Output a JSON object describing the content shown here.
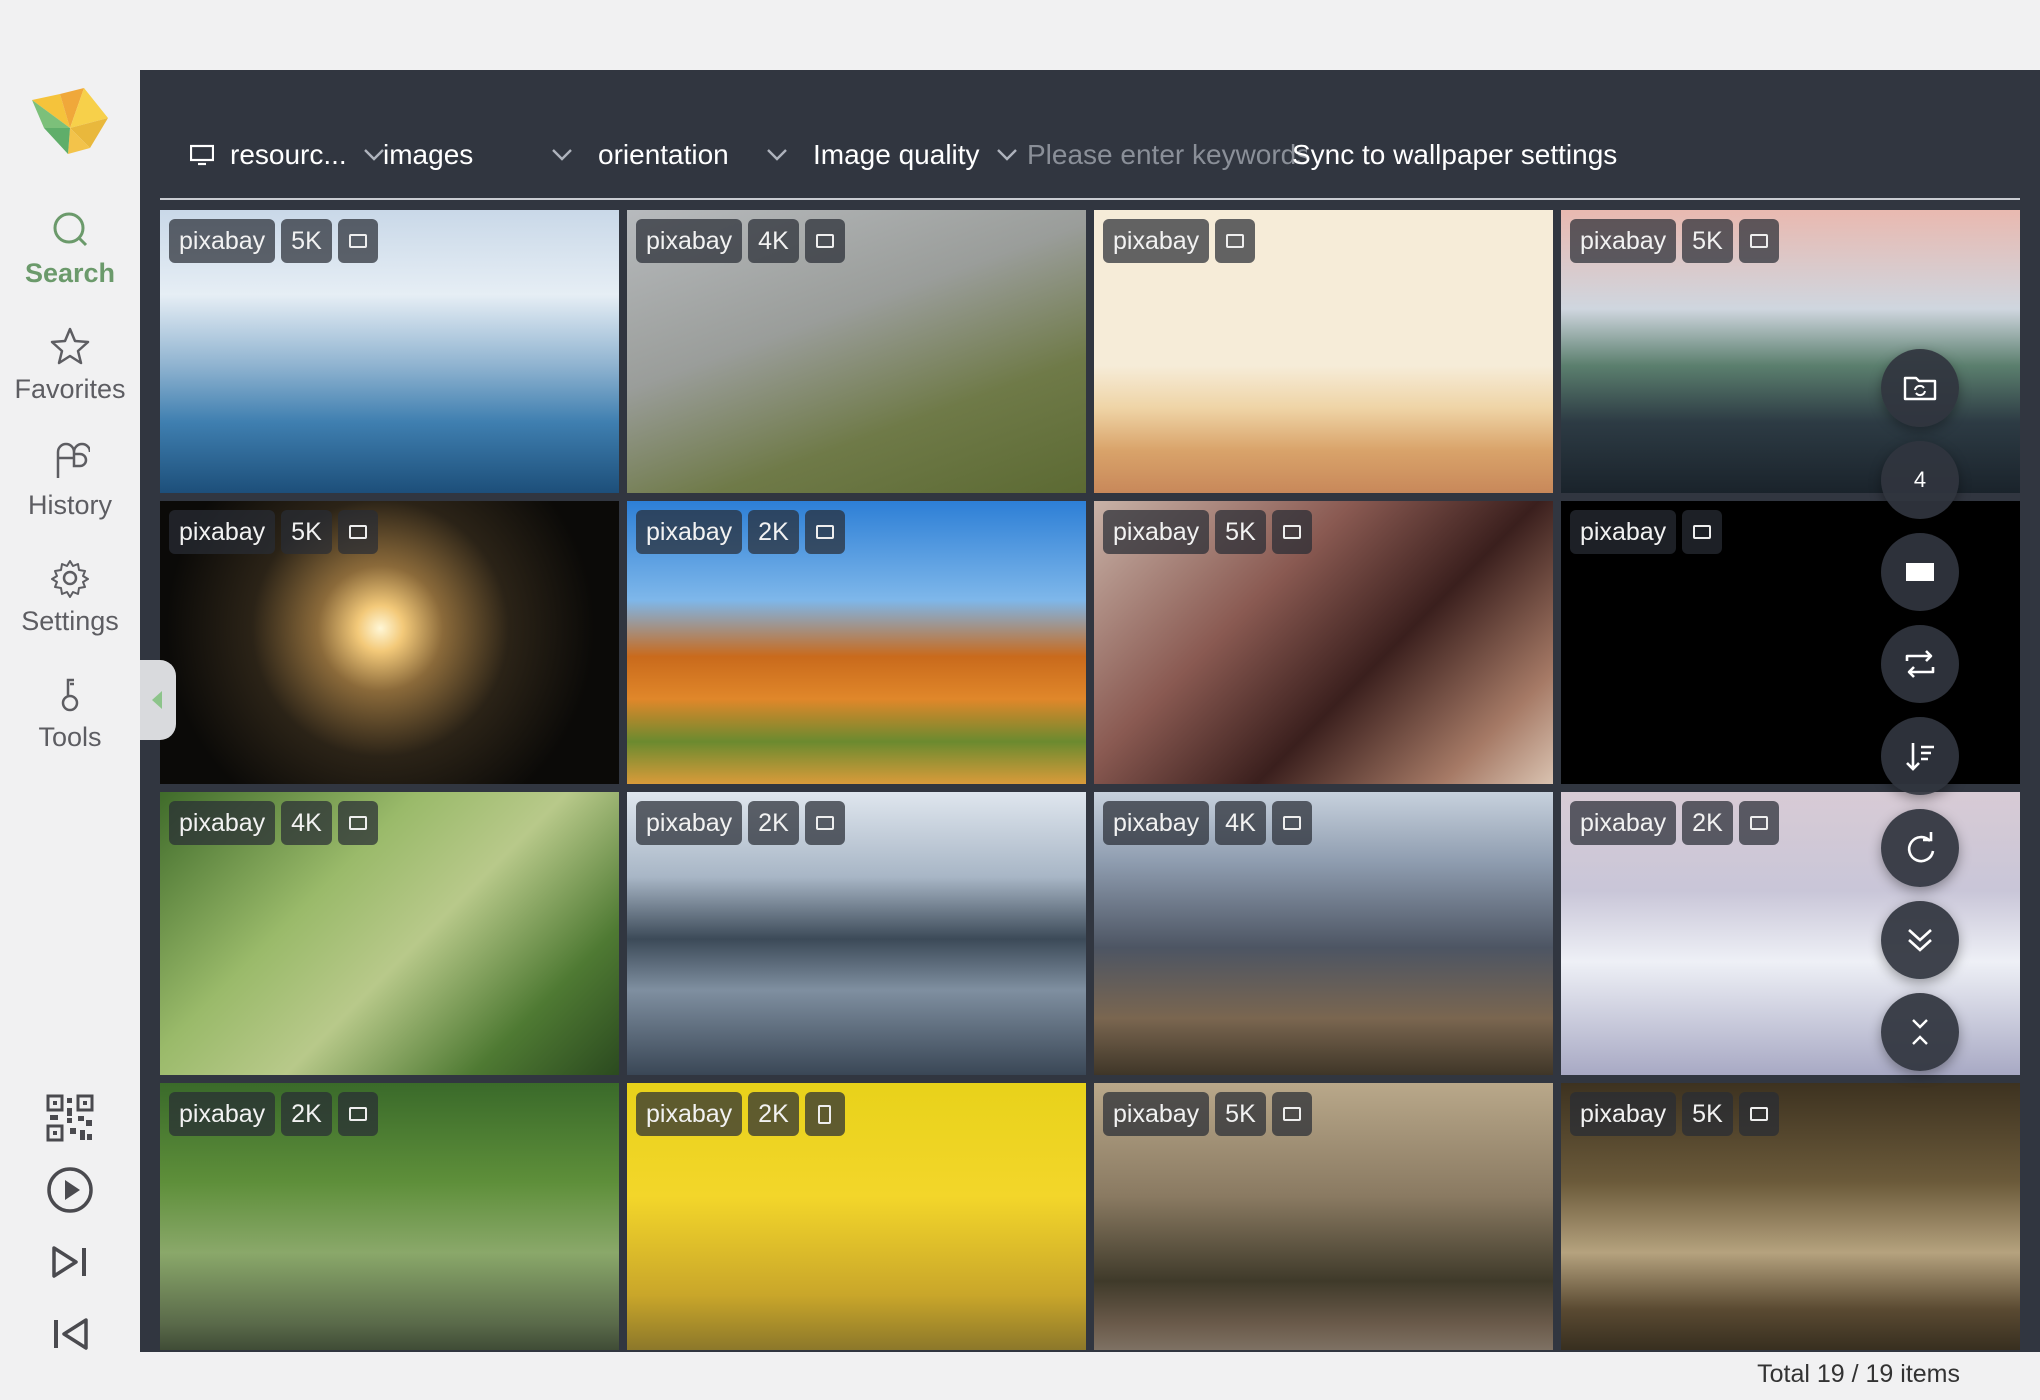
{
  "sidebar": {
    "nav": [
      {
        "label": "Search",
        "icon": "search-icon",
        "active": true
      },
      {
        "label": "Favorites",
        "icon": "star-icon",
        "active": false
      },
      {
        "label": "History",
        "icon": "history-icon",
        "active": false
      },
      {
        "label": "Settings",
        "icon": "gear-icon",
        "active": false
      },
      {
        "label": "Tools",
        "icon": "tools-icon",
        "active": false
      }
    ],
    "bottom_icons": [
      "qr-code-icon",
      "play-icon",
      "next-icon",
      "previous-icon"
    ]
  },
  "toolbar": {
    "resource_select": "resourc...",
    "type_select": "images",
    "orientation_select": "orientation",
    "quality_select": "Image quality",
    "keyword_placeholder": "Please enter keywords",
    "sync_label": "Sync to wallpaper settings"
  },
  "grid": {
    "tiles": [
      {
        "source": "pixabay",
        "quality": "5K",
        "orientation": "landscape"
      },
      {
        "source": "pixabay",
        "quality": "4K",
        "orientation": "landscape"
      },
      {
        "source": "pixabay",
        "quality": "",
        "orientation": "landscape"
      },
      {
        "source": "pixabay",
        "quality": "5K",
        "orientation": "landscape"
      },
      {
        "source": "pixabay",
        "quality": "5K",
        "orientation": "landscape"
      },
      {
        "source": "pixabay",
        "quality": "2K",
        "orientation": "landscape"
      },
      {
        "source": "pixabay",
        "quality": "5K",
        "orientation": "landscape"
      },
      {
        "source": "pixabay",
        "quality": "",
        "orientation": "landscape"
      },
      {
        "source": "pixabay",
        "quality": "4K",
        "orientation": "landscape"
      },
      {
        "source": "pixabay",
        "quality": "2K",
        "orientation": "landscape"
      },
      {
        "source": "pixabay",
        "quality": "4K",
        "orientation": "landscape"
      },
      {
        "source": "pixabay",
        "quality": "2K",
        "orientation": "landscape"
      },
      {
        "source": "pixabay",
        "quality": "2K",
        "orientation": "landscape"
      },
      {
        "source": "pixabay",
        "quality": "2K",
        "orientation": "portrait"
      },
      {
        "source": "pixabay",
        "quality": "5K",
        "orientation": "landscape"
      },
      {
        "source": "pixabay",
        "quality": "5K",
        "orientation": "landscape"
      }
    ]
  },
  "fabs": {
    "page_number": "4",
    "icons": [
      "folder-sync-icon",
      "page-indicator",
      "fullscreen-icon",
      "swap-icon",
      "sort-icon",
      "refresh-icon",
      "scroll-bottom-icon",
      "collapse-icon"
    ]
  },
  "status": {
    "total": "Total 19 / 19 items"
  }
}
